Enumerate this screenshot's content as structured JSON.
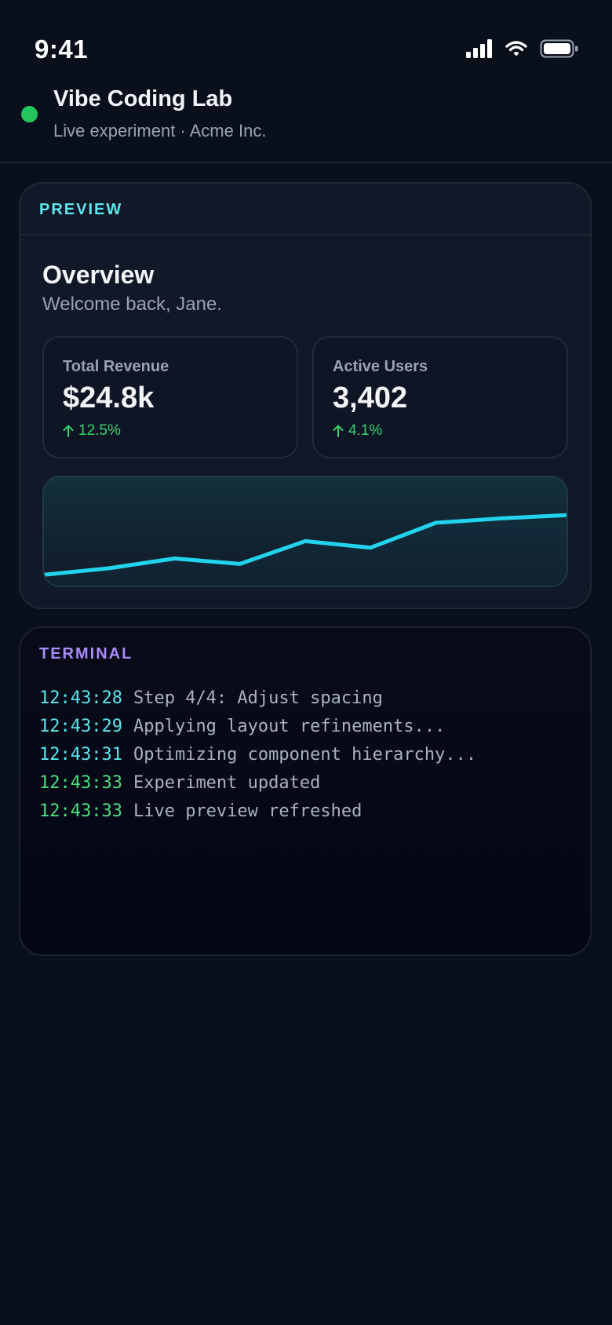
{
  "status_bar": {
    "time": "9:41",
    "icons": [
      "cellular-signal-icon",
      "wifi-icon",
      "battery-icon"
    ]
  },
  "header": {
    "title": "Vibe Coding Lab",
    "subtitle": "Live experiment · Acme Inc.",
    "status_color": "#22c55e"
  },
  "preview": {
    "label": "PREVIEW",
    "overview_title": "Overview",
    "overview_subtitle": "Welcome back, Jane.",
    "stats": [
      {
        "label": "Total Revenue",
        "value": "$24.8k",
        "change": "12.5%",
        "trend": "up"
      },
      {
        "label": "Active Users",
        "value": "3,402",
        "change": "4.1%",
        "trend": "up"
      }
    ]
  },
  "chart_data": {
    "type": "line",
    "x": [
      0,
      1,
      2,
      3,
      4,
      5,
      6,
      7,
      8
    ],
    "values": [
      10,
      16,
      25,
      20,
      41,
      35,
      58,
      62,
      65
    ],
    "ylim": [
      0,
      100
    ],
    "grid": false,
    "color": "#22d3ee"
  },
  "terminal": {
    "label": "TERMINAL",
    "lines": [
      {
        "time": "12:43:28",
        "message": "Step 4/4: Adjust spacing",
        "level": "info"
      },
      {
        "time": "12:43:29",
        "message": "Applying layout refinements...",
        "level": "info"
      },
      {
        "time": "12:43:31",
        "message": "Optimizing component hierarchy...",
        "level": "info"
      },
      {
        "time": "12:43:33",
        "message": "Experiment updated",
        "level": "success"
      },
      {
        "time": "12:43:33",
        "message": "Live preview refreshed",
        "level": "success"
      }
    ]
  }
}
